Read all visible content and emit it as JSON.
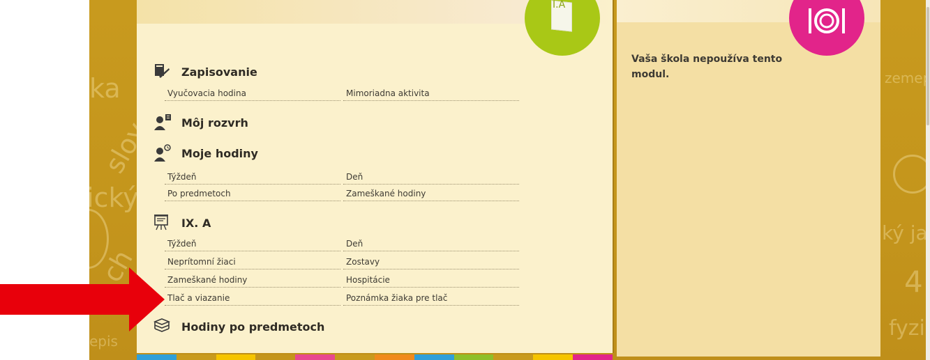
{
  "background_words": [
    "ka",
    "slov",
    "ický j",
    "ch",
    "epis",
    "zemep",
    "ký jaz",
    "4",
    "fyzi"
  ],
  "main": {
    "class_badge_label": "I.A",
    "sections": [
      {
        "title": "Zapisovanie",
        "icon": "pencil-writing-icon",
        "links": [
          [
            "Vyučovacia hodina",
            "Mimoriadna aktivita"
          ]
        ]
      },
      {
        "title": "Môj rozvrh",
        "icon": "teacher-schedule-icon",
        "links": []
      },
      {
        "title": "Moje hodiny",
        "icon": "teacher-clock-icon",
        "links": [
          [
            "Týždeň",
            "Deň"
          ],
          [
            "Po predmetoch",
            "Zameškané hodiny"
          ]
        ]
      },
      {
        "title": "IX. A",
        "icon": "classroom-board-icon",
        "links": [
          [
            "Týždeň",
            "Deň"
          ],
          [
            "Neprítomní žiaci",
            "Zostavy"
          ],
          [
            "Zameškané hodiny",
            "Hospitácie"
          ],
          [
            "Tlač a viazanie",
            "Poznámka žiaka pre tlač"
          ]
        ]
      },
      {
        "title": "Hodiny po predmetoch",
        "icon": "books-stack-icon",
        "links": []
      }
    ]
  },
  "side": {
    "badge_icon": "plate-fork-knife-icon",
    "message": "Vaša škola nepoužíva tento modul."
  },
  "colors": {
    "background_gold": "#c89a1e",
    "panel": "#fbf1cc",
    "side_panel": "#f4dfa4",
    "class_badge": "#a9c816",
    "lunch_badge": "#e2248a",
    "arrow": "#e8000b"
  },
  "stripe_colors": [
    "#2f9fd8",
    "#c89a1e",
    "#f5c400",
    "#c4951c",
    "#e8488f",
    "#c89a1e",
    "#f08a1c",
    "#2f9fd8",
    "#8fbf2a",
    "#c89a1e",
    "#f5c400",
    "#e2248a"
  ]
}
